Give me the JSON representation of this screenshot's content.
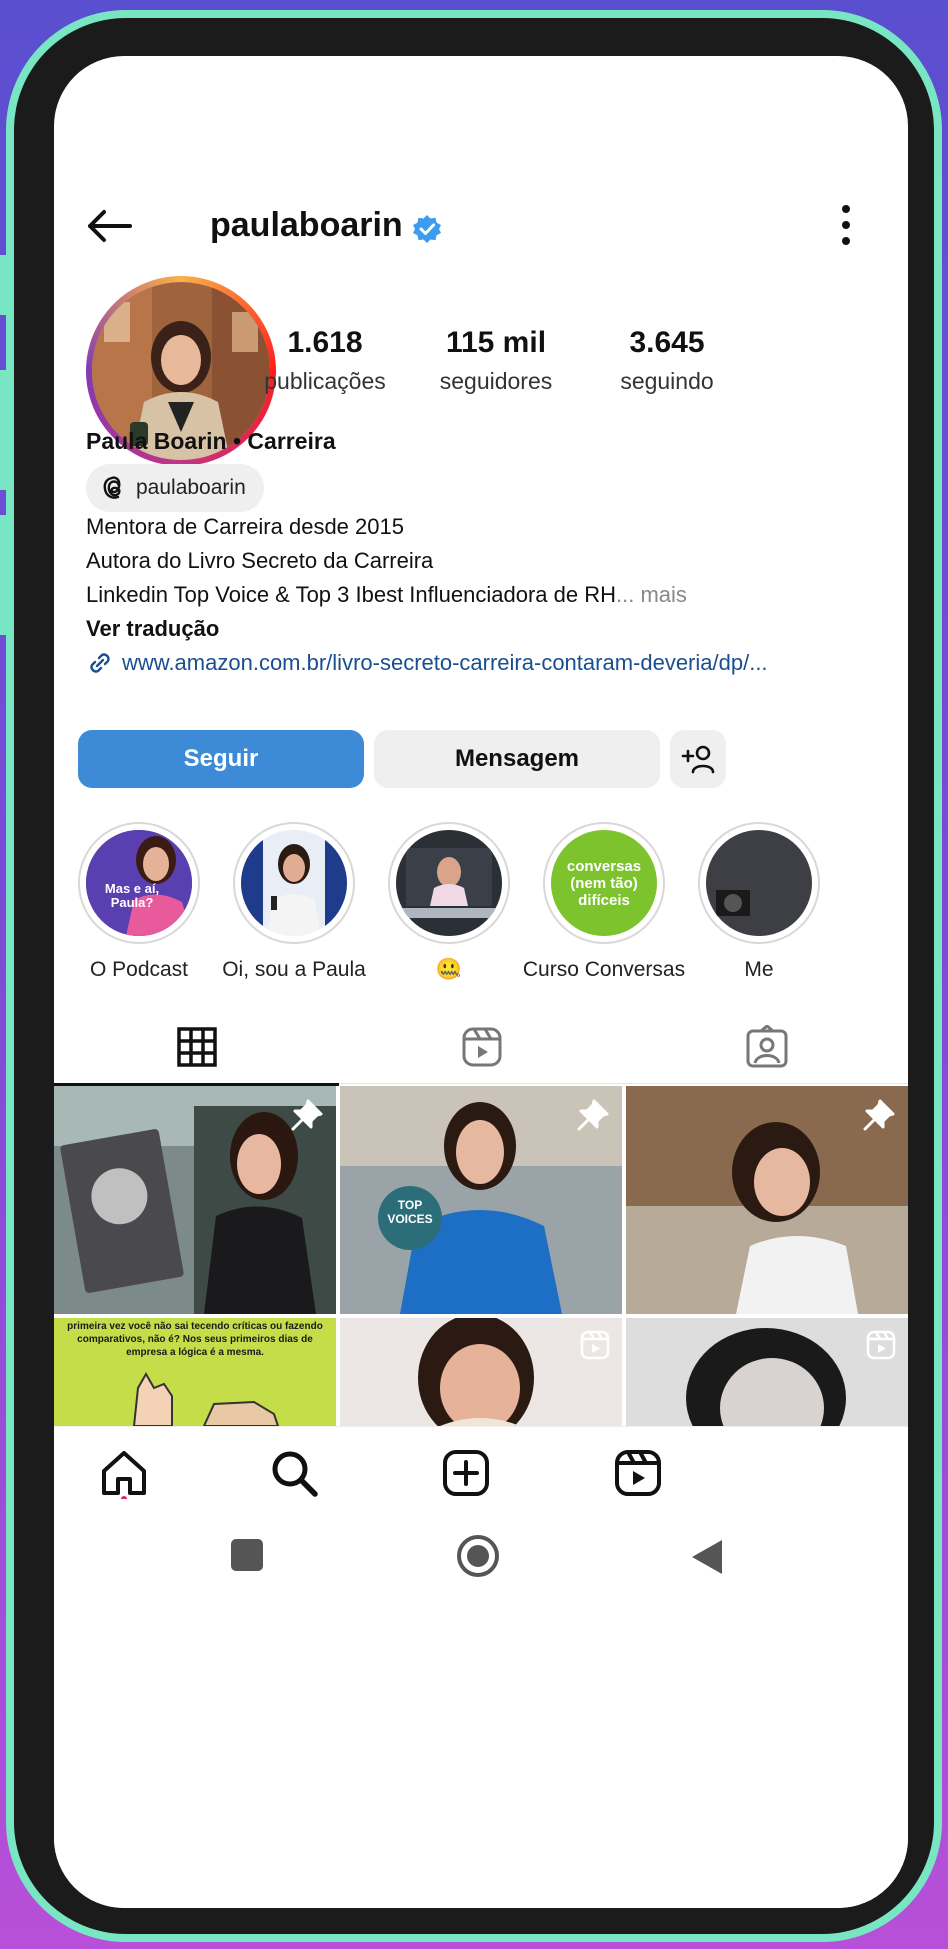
{
  "header": {
    "username": "paulaboarin"
  },
  "profile": {
    "stats": [
      {
        "value": "1.618",
        "label": "publicações"
      },
      {
        "value": "115 mil",
        "label": "seguidores"
      },
      {
        "value": "3.645",
        "label": "seguindo"
      }
    ],
    "display_name": "Paula Boarin • Carreira",
    "threads_handle": "paulaboarin",
    "bio_lines": [
      "Mentora de Carreira desde 2015",
      "Autora do Livro Secreto da Carreira",
      "Linkedin Top Voice & Top 3 Ibest Influenciadora de RH"
    ],
    "bio_more": "... mais",
    "translate_label": "Ver tradução",
    "link_text": "www.amazon.com.br/livro-secreto-carreira-contaram-deveria/dp/..."
  },
  "actions": {
    "follow_label": "Seguir",
    "message_label": "Mensagem"
  },
  "highlights": [
    {
      "label": "O Podcast",
      "cover_text": "Mas e aí, Paula?"
    },
    {
      "label": "Oi, sou a Paula",
      "cover_text": ""
    },
    {
      "label": "🤐",
      "cover_text": ""
    },
    {
      "label": "Curso Conversas",
      "cover_text": "conversas (nem tão) difíceis"
    },
    {
      "label": "Me",
      "cover_text": ""
    }
  ],
  "grid": {
    "top_voices_badge": "TOP VOICES",
    "post4_text": "primeira vez você não sai tecendo críticas ou fazendo comparativos, não é? Nos seus primeiros dias de empresa a lógica é a mesma."
  },
  "colors": {
    "accent": "#3d8ad6",
    "frame": "#79e6c3",
    "verified": "#3b9cf0"
  },
  "icons": [
    "back-arrow-icon",
    "verified-badge-icon",
    "more-vertical-icon",
    "threads-icon",
    "link-icon",
    "add-user-icon",
    "grid-icon",
    "reels-icon",
    "tagged-icon",
    "pin-icon",
    "home-icon",
    "search-icon",
    "create-icon",
    "reels-nav-icon",
    "android-recents-icon",
    "android-home-icon",
    "android-back-icon"
  ]
}
